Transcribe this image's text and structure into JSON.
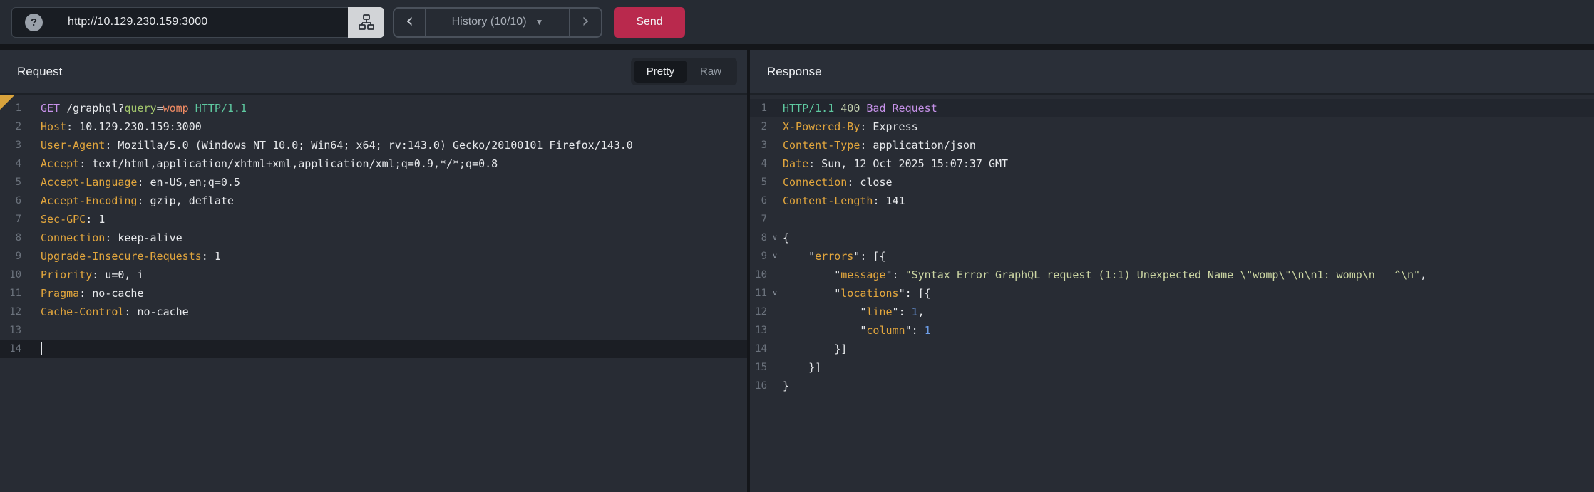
{
  "topbar": {
    "help_label": "?",
    "url_value": "http://10.129.230.159:3000",
    "history_prev": "‹",
    "history_label": "History (10/10)",
    "history_caret": "▼",
    "history_next": "›",
    "send_label": "Send"
  },
  "request_panel": {
    "title": "Request",
    "tabs": [
      {
        "label": "Pretty",
        "active": true
      },
      {
        "label": "Raw",
        "active": false
      }
    ],
    "active_line": 14,
    "caret_line": 14,
    "lines": [
      [
        [
          "method",
          "GET"
        ],
        [
          "plain",
          " /graphql?"
        ],
        [
          "param",
          "query"
        ],
        [
          "plain",
          "="
        ],
        [
          "pval",
          "womp"
        ],
        [
          "plain",
          " "
        ],
        [
          "version",
          "HTTP/1.1"
        ]
      ],
      [
        [
          "hname",
          "Host"
        ],
        [
          "plain",
          ": 10.129.230.159:3000"
        ]
      ],
      [
        [
          "hname",
          "User-Agent"
        ],
        [
          "plain",
          ": Mozilla/5.0 (Windows NT 10.0; Win64; x64; rv:143.0) Gecko/20100101 Firefox/143.0"
        ]
      ],
      [
        [
          "hname",
          "Accept"
        ],
        [
          "plain",
          ": text/html,application/xhtml+xml,application/xml;q=0.9,*/*;q=0.8"
        ]
      ],
      [
        [
          "hname",
          "Accept-Language"
        ],
        [
          "plain",
          ": en-US,en;q=0.5"
        ]
      ],
      [
        [
          "hname",
          "Accept-Encoding"
        ],
        [
          "plain",
          ": gzip, deflate"
        ]
      ],
      [
        [
          "hname",
          "Sec-GPC"
        ],
        [
          "plain",
          ": 1"
        ]
      ],
      [
        [
          "hname",
          "Connection"
        ],
        [
          "plain",
          ": keep-alive"
        ]
      ],
      [
        [
          "hname",
          "Upgrade-Insecure-Requests"
        ],
        [
          "plain",
          ": 1"
        ]
      ],
      [
        [
          "hname",
          "Priority"
        ],
        [
          "plain",
          ": u=0, i"
        ]
      ],
      [
        [
          "hname",
          "Pragma"
        ],
        [
          "plain",
          ": no-cache"
        ]
      ],
      [
        [
          "hname",
          "Cache-Control"
        ],
        [
          "plain",
          ": no-cache"
        ]
      ],
      [],
      []
    ]
  },
  "response_panel": {
    "title": "Response",
    "active_line": 1,
    "fold_lines": [
      8,
      9,
      11
    ],
    "fold_glyph": "∨",
    "lines": [
      [
        [
          "version",
          "HTTP/1.1"
        ],
        [
          "plain",
          " "
        ],
        [
          "status",
          "400"
        ],
        [
          "plain",
          " "
        ],
        [
          "reason",
          "Bad Request"
        ]
      ],
      [
        [
          "hname",
          "X-Powered-By"
        ],
        [
          "plain",
          ": Express"
        ]
      ],
      [
        [
          "hname",
          "Content-Type"
        ],
        [
          "plain",
          ": application/json"
        ]
      ],
      [
        [
          "hname",
          "Date"
        ],
        [
          "plain",
          ": Sun, 12 Oct 2025 15:07:37 GMT"
        ]
      ],
      [
        [
          "hname",
          "Connection"
        ],
        [
          "plain",
          ": close"
        ]
      ],
      [
        [
          "hname",
          "Content-Length"
        ],
        [
          "plain",
          ": 141"
        ]
      ],
      [],
      [
        [
          "plain",
          "{"
        ]
      ],
      [
        [
          "plain",
          "    "
        ],
        [
          "punct",
          "\""
        ],
        [
          "key",
          "errors"
        ],
        [
          "punct",
          "\""
        ],
        [
          "plain",
          ": [{"
        ]
      ],
      [
        [
          "plain",
          "        "
        ],
        [
          "punct",
          "\""
        ],
        [
          "key",
          "message"
        ],
        [
          "punct",
          "\""
        ],
        [
          "plain",
          ": "
        ],
        [
          "string",
          "\"Syntax Error GraphQL request (1:1) Unexpected Name \\\"womp\\\"\\n\\n1: womp\\n   ^\\n\""
        ],
        [
          "plain",
          ","
        ]
      ],
      [
        [
          "plain",
          "        "
        ],
        [
          "punct",
          "\""
        ],
        [
          "key",
          "locations"
        ],
        [
          "punct",
          "\""
        ],
        [
          "plain",
          ": [{"
        ]
      ],
      [
        [
          "plain",
          "            "
        ],
        [
          "punct",
          "\""
        ],
        [
          "key",
          "line"
        ],
        [
          "punct",
          "\""
        ],
        [
          "plain",
          ": "
        ],
        [
          "number",
          "1"
        ],
        [
          "plain",
          ","
        ]
      ],
      [
        [
          "plain",
          "            "
        ],
        [
          "punct",
          "\""
        ],
        [
          "key",
          "column"
        ],
        [
          "punct",
          "\""
        ],
        [
          "plain",
          ": "
        ],
        [
          "number",
          "1"
        ]
      ],
      [
        [
          "plain",
          "        }]"
        ]
      ],
      [
        [
          "plain",
          "    }]"
        ]
      ],
      [
        [
          "plain",
          "}"
        ]
      ]
    ]
  },
  "colors": {
    "send_button": "#b9294d",
    "corner_marker": "#d9a33c",
    "syntax_method": "#c792ea",
    "syntax_header_name": "#e2a63d",
    "syntax_version": "#5ec9a0",
    "syntax_query_param": "#a3c76d",
    "syntax_query_value": "#ee8a63",
    "syntax_status_code": "#c3d1af",
    "syntax_reason": "#c792ea",
    "syntax_json_key": "#e2a63d",
    "syntax_json_string": "#ccd6a3",
    "syntax_json_number": "#6d9ee8"
  }
}
